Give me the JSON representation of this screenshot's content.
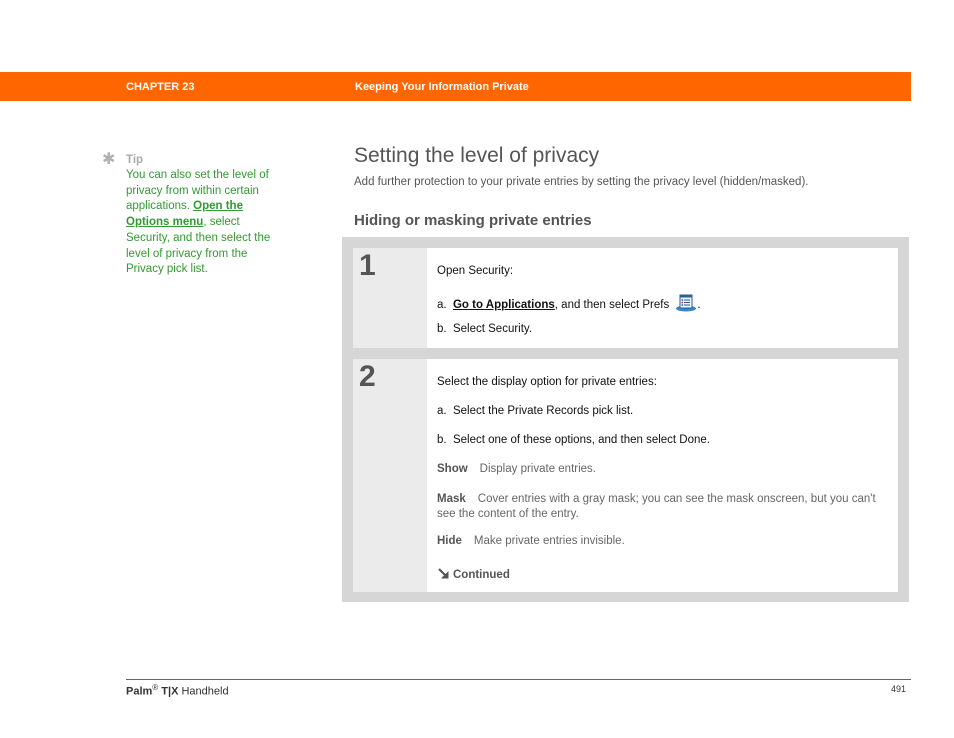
{
  "header": {
    "chapter": "CHAPTER 23",
    "title": "Keeping Your Information Private",
    "bar_color": "#ff6600"
  },
  "tip": {
    "icon": "asterisk-icon",
    "label": "Tip",
    "text_before": "You can also set the level of privacy from within certain applications.",
    "link": "Open the Options menu",
    "text_after": ", select Security, and then select the level of privacy from the Privacy pick list.",
    "color": "#339933"
  },
  "main": {
    "title": "Setting the level of privacy",
    "subtitle": "Add further protection to your private entries by setting the privacy level (hidden/masked).",
    "section_heading": "Hiding or masking private entries"
  },
  "steps": [
    {
      "number": "1",
      "intro": "Open Security:",
      "items": [
        {
          "prefix": "a.",
          "link": "Go to Applications",
          "text": ", and then select Prefs",
          "icon": "prefs-icon",
          "suffix": "."
        },
        {
          "prefix": "b.",
          "text": "Select Security."
        }
      ]
    },
    {
      "number": "2",
      "intro": "Select the display option for private entries:",
      "items": [
        {
          "prefix": "a.",
          "text": "Select the Private Records pick list."
        },
        {
          "prefix": "b.",
          "text": "Select one of these options, and then select Done."
        }
      ],
      "options": [
        {
          "term": "Show",
          "desc": "Display private entries."
        },
        {
          "term": "Mask",
          "desc": "Cover entries with a gray mask; you can see the mask onscreen, but you can't see the content of the entry."
        },
        {
          "term": "Hide",
          "desc": "Make private entries invisible."
        }
      ],
      "continued": "Continued"
    }
  ],
  "footer": {
    "brand": "Palm",
    "reg": "®",
    "model": "T|X",
    "product": "Handheld",
    "page_number": "491"
  }
}
